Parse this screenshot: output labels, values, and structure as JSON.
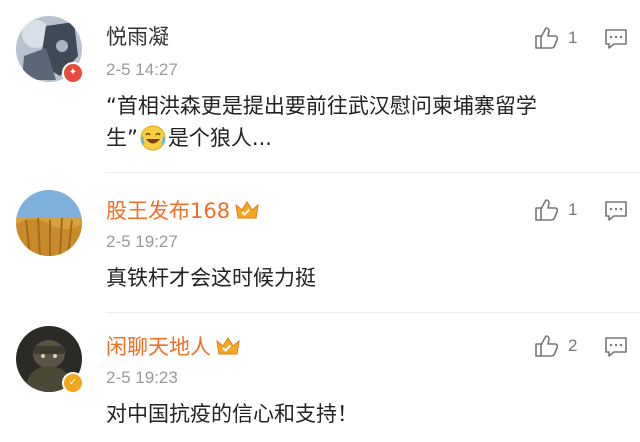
{
  "comments": [
    {
      "username": "悦雨凝",
      "time": "2-5 14:27",
      "text_line1": "“首相洪森更是提出要前往武汉慰问柬埔寨留学",
      "text_line2_before": "生”",
      "text_line2_after": "是个狼人...",
      "emoji": "laugh-cry-emoji",
      "likes": "1",
      "avatar_badge": "vip-red-badge"
    },
    {
      "username": "股王发布168",
      "time": "2-5 19:27",
      "text": "真铁杆才会这时候力挺",
      "likes": "1"
    },
    {
      "username": "闲聊天地人",
      "time": "2-5 19:23",
      "text": "对中国抗疫的信心和支持！",
      "likes": "2",
      "avatar_badge": "verified-gold-badge"
    }
  ],
  "icons": {
    "like": "thumbs-up-icon",
    "reply": "comment-bubble-icon",
    "vip": "crown-vip-icon"
  },
  "colors": {
    "vip_name": "#f36d22",
    "normal_name": "#333333",
    "time": "#9a9a9a"
  }
}
